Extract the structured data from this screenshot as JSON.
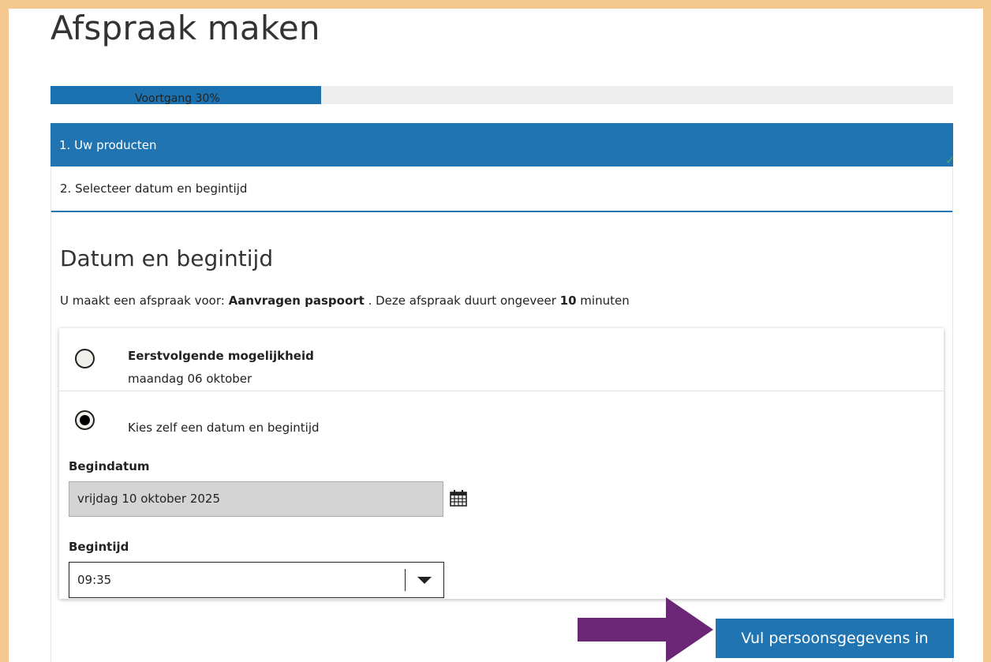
{
  "page": {
    "title": "Afspraak maken"
  },
  "progress": {
    "label": "Voortgang 30%",
    "percent": 30
  },
  "steps": [
    {
      "label": "1. Uw producten",
      "active": true,
      "completed": true
    },
    {
      "label": "2. Selecteer datum en begintijd",
      "active": false
    }
  ],
  "section": {
    "title": "Datum en begintijd",
    "intro_prefix": "U maakt een afspraak voor: ",
    "product": "Aanvragen paspoort",
    "intro_mid": " . Deze afspraak duurt ongeveer ",
    "duration": "10",
    "intro_suffix": " minuten"
  },
  "options": {
    "first": {
      "title": "Eerstvolgende mogelijkheid",
      "subtitle": "maandag 06 oktober",
      "selected": false
    },
    "custom": {
      "label": "Kies zelf een datum en begintijd",
      "selected": true
    }
  },
  "date_field": {
    "label": "Begindatum",
    "value": "vrijdag 10 oktober 2025"
  },
  "time_field": {
    "label": "Begintijd",
    "value": "09:35"
  },
  "next_button": {
    "label": "Vul persoonsgegevens in"
  },
  "colors": {
    "primary": "#1f74b1",
    "frame": "#f5c88f",
    "arrow": "#6b2776",
    "check": "#4caf50"
  },
  "icons": {
    "calendar": "calendar-icon",
    "check": "check-icon",
    "caret": "chevron-down-icon",
    "arrow": "arrow-right-icon"
  }
}
